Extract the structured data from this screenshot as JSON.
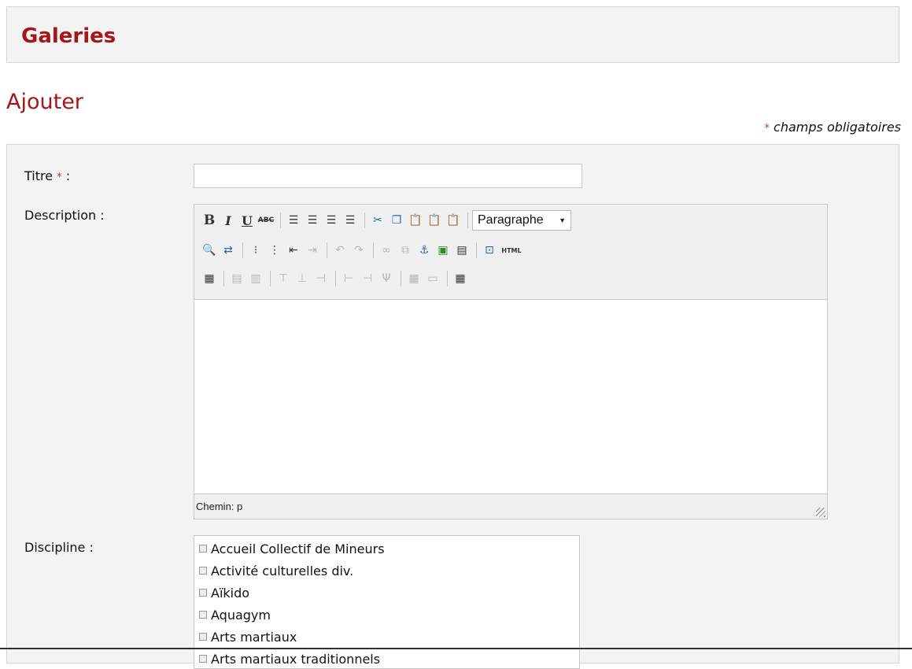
{
  "header": {
    "title": "Galeries"
  },
  "section": {
    "title": "Ajouter"
  },
  "required_note": {
    "star": "*",
    "text": "champs obligatoires"
  },
  "form": {
    "title_field": {
      "label": "Titre",
      "star": "*",
      "colon": " :",
      "value": ""
    },
    "description_field": {
      "label": "Description :"
    },
    "discipline_field": {
      "label": "Discipline :"
    }
  },
  "editor": {
    "block_format": "Paragraphe",
    "status_path": "Chemin: p",
    "html_button": "HTML",
    "bold_label": "B",
    "italic_label": "I",
    "underline_label": "U",
    "strike_label": "ABC"
  },
  "disciplines": [
    "Accueil Collectif de Mineurs",
    "Activité culturelles div.",
    "Aïkido",
    "Aquagym",
    "Arts martiaux",
    "Arts martiaux traditionnels"
  ]
}
